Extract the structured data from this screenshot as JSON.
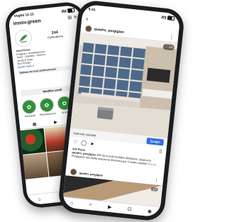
{
  "back_phone": {
    "status": {
      "time": "Voglia 11:11",
      "right": ""
    },
    "header": {
      "username": "innov.green",
      "add_icon": "plus-square-icon",
      "menu_icon": "hamburger-icon"
    },
    "profile": {
      "posts_count": "244",
      "posts_label": "Publications",
      "followers_count": "",
      "followers_label": "",
      "following_count": "",
      "following_label": ""
    },
    "bio": {
      "name": "InnovGreen",
      "line1": "Progetti e rimodellamenti",
      "line2": "Casa · Giardino · Esterno",
      "line3": "Verde & Solar",
      "line4": "Eco Design",
      "link": "quadro-laghi.it"
    },
    "dashboard_label": "Tableau de bord professionnel",
    "modify_label": "Modifier profil",
    "highlights": [
      {
        "label": "Pavimenti"
      },
      {
        "label": "Ristrutturazioni"
      },
      {
        "label": "Arredo"
      }
    ],
    "nav_icons": [
      "home-icon",
      "search-icon",
      "reels-icon",
      "shop-icon",
      "profile-icon"
    ]
  },
  "front_phone": {
    "status": {
      "time": "9:41"
    },
    "header": {
      "back_icon": "chevron-left-icon",
      "title": ""
    },
    "post": {
      "username": "quadro_pergigian",
      "menu_icon": "more-icon",
      "counter": "1/3",
      "cta_label": "Vedi tutti i prodotti",
      "cta_button": "Scopri",
      "likes": "222 Piace",
      "caption_user": "quadro_pergigian",
      "caption_text": "365 lat trucchi mobiles rifinizione: Qualcuno Pergiganci una bella soluzione dinamica per il vostro salotto!",
      "more": "Pensa ...",
      "view_comments": "",
      "time_ago": ""
    },
    "post2": {
      "username": "quadro_pergigian",
      "counter": "1/3"
    },
    "nav_icons": [
      "home-icon",
      "search-icon",
      "reels-icon",
      "shop-icon",
      "profile-icon"
    ]
  },
  "colors": {
    "phone_frame": "#1c1d20",
    "accent_green": "#2f8f3a",
    "cta_blue": "#2f6fe0",
    "link_blue": "#1f4e8c"
  }
}
